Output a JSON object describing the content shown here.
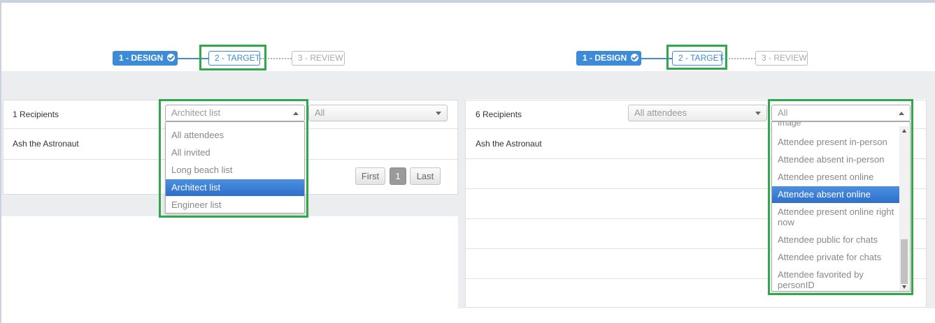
{
  "left": {
    "steps": {
      "design": "1 - DESIGN",
      "target": "2 - TARGET",
      "review": "3 - REVIEW"
    },
    "recipients_label": "1 Recipients",
    "list_select": {
      "value": "Architect list"
    },
    "filter_select": {
      "value": "All"
    },
    "row": "Ash the Astronaut",
    "dropdown_options": [
      "All attendees",
      "All invited",
      "Long beach list",
      "Architect list",
      "Engineer list"
    ],
    "active_option": "Architect list",
    "pagination": {
      "first": "First",
      "page": "1",
      "last": "Last"
    }
  },
  "right": {
    "steps": {
      "design": "1 - DESIGN",
      "target": "2 - TARGET",
      "review": "3 - REVIEW"
    },
    "recipients_label": "6 Recipients",
    "list_select": {
      "value": "All attendees"
    },
    "filter_select": {
      "value": "All"
    },
    "row": "Ash the Astronaut",
    "dropdown_partial_top": "Image",
    "dropdown_options": [
      "Attendee present in-person",
      "Attendee absent in-person",
      "Attendee present online",
      "Attendee absent online",
      "Attendee present online right now",
      "Attendee public for chats",
      "Attendee private for chats",
      "Attendee favorited by personID"
    ],
    "active_option": "Attendee absent online"
  },
  "colors": {
    "accent": "#3c8ad8",
    "highlight_box": "#2ea84a",
    "active_option": "#3c7fd6"
  }
}
